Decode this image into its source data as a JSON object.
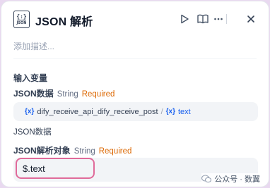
{
  "header": {
    "title": "JSON 解析",
    "icon_braces": "{:}",
    "icon_label": "JSON"
  },
  "description_placeholder": "添加描述...",
  "input_variables": {
    "section_title": "输入变量",
    "field": {
      "label": "JSON数据",
      "type": "String",
      "required": "Required",
      "variable_icon": "{x}",
      "node_name": "dify_receive_api_dify_receive_post",
      "separator": "/",
      "variable_icon2": "{x}",
      "variable_name": "text",
      "description": "JSON数据"
    }
  },
  "parse_target": {
    "label": "JSON解析对象",
    "type": "String",
    "required": "Required",
    "value": "$.text"
  },
  "watermark": {
    "text": "公众号 · 数翼"
  },
  "colors": {
    "accent_blue": "#155eef",
    "required_orange": "#dc6803",
    "highlight_pink": "#e06a9a",
    "background": "#e9d9f0"
  }
}
